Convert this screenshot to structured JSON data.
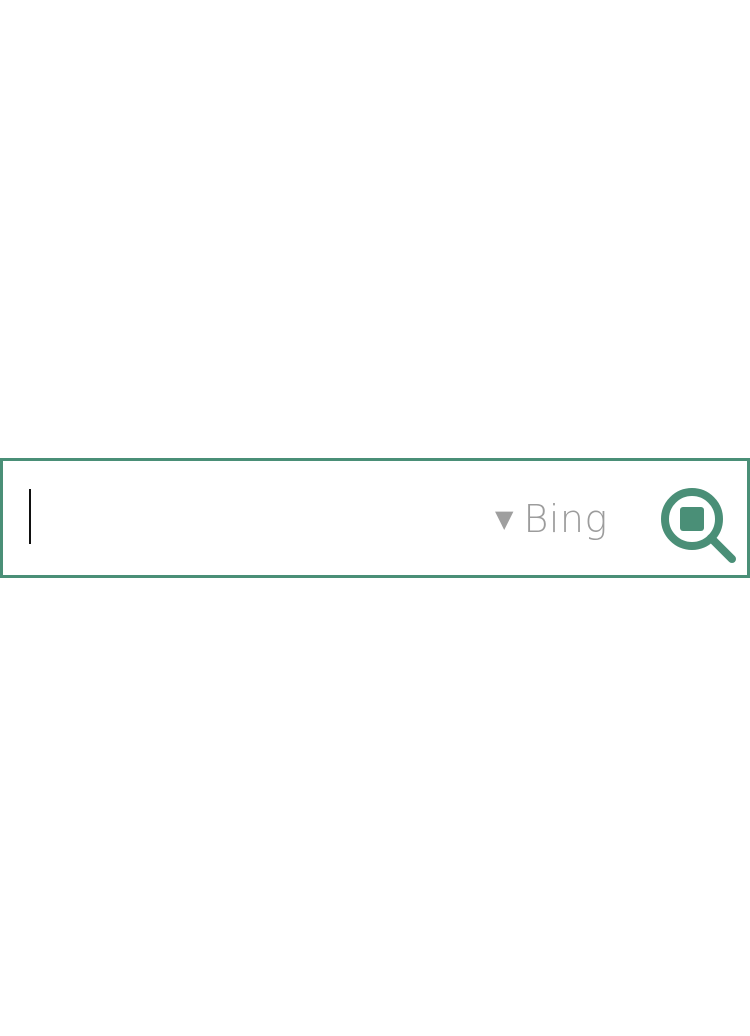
{
  "search": {
    "query": "",
    "placeholder": "",
    "engine": "Bing",
    "engine_dropdown_icon": "caret-down-icon",
    "submit_icon": "search-icon"
  },
  "colors": {
    "accent": "#4a8f77",
    "accent_dark": "#3f7f68",
    "engine_text": "#9c9c9c"
  }
}
